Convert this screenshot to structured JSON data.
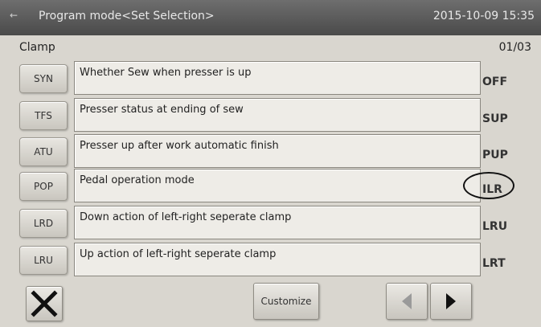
{
  "header": {
    "back_glyph": "←",
    "title": "Program mode<Set Selection>",
    "datetime": "2015-10-09 15:35"
  },
  "section": {
    "title": "Clamp",
    "page": "01/03"
  },
  "rows": [
    {
      "code": "SYN",
      "label": "Whether Sew when presser is up",
      "value": "OFF"
    },
    {
      "code": "TFS",
      "label": "Presser status at ending of sew",
      "value": "SUP"
    },
    {
      "code": "ATU",
      "label": "Presser up after work automatic finish",
      "value": "PUP"
    },
    {
      "code": "POP",
      "label": "Pedal operation mode",
      "value": "ILR",
      "highlighted": true
    },
    {
      "code": "LRD",
      "label": "Down action of left-right seperate clamp",
      "value": "LRU"
    },
    {
      "code": "LRU",
      "label": "Up action of left-right seperate clamp",
      "value": "LRT"
    }
  ],
  "footer": {
    "close_icon": "close-icon",
    "customize_label": "Customize",
    "prev_icon": "arrow-left-icon",
    "next_icon": "arrow-right-icon"
  }
}
